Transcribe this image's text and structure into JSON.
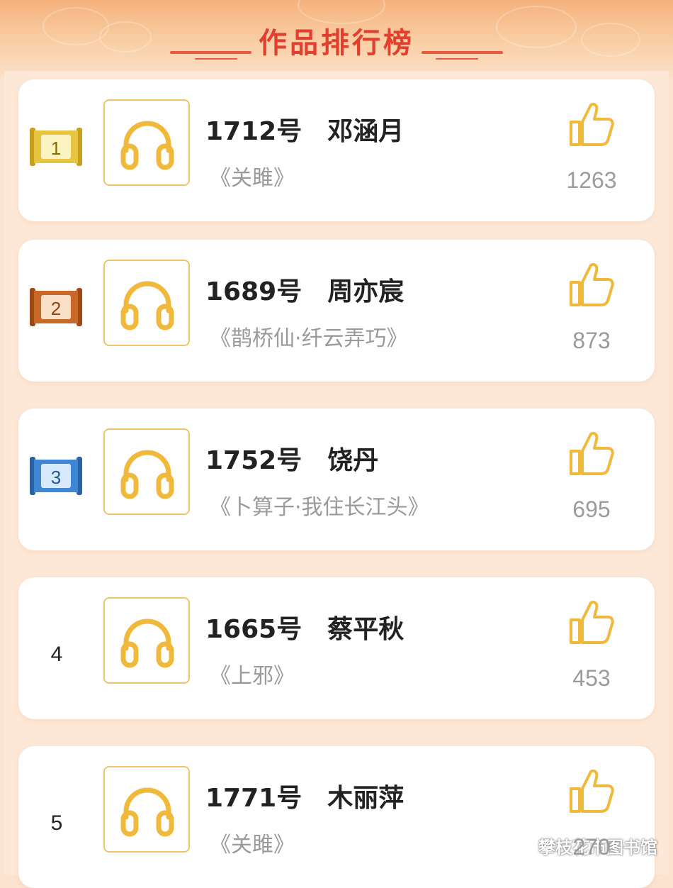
{
  "header": {
    "title": "作品排行榜"
  },
  "colors": {
    "accent": "#e0402d",
    "gold": "#f0b93b",
    "badge_gold": "#e7c540",
    "badge_bronze": "#c8692a",
    "badge_blue": "#3f86d3"
  },
  "entries": [
    {
      "rank": "1",
      "number": "1712号",
      "name": "邓涵月",
      "work": "《关雎》",
      "likes": "1263",
      "badge": "gold"
    },
    {
      "rank": "2",
      "number": "1689号",
      "name": "周亦宸",
      "work": "《鹊桥仙·纤云弄巧》",
      "likes": "873",
      "badge": "bronze"
    },
    {
      "rank": "3",
      "number": "1752号",
      "name": "饶丹",
      "work": "《卜算子·我住长江头》",
      "likes": "695",
      "badge": "blue"
    },
    {
      "rank": "4",
      "number": "1665号",
      "name": "蔡平秋",
      "work": "《上邪》",
      "likes": "453",
      "badge": "none"
    },
    {
      "rank": "5",
      "number": "1771号",
      "name": "木丽萍",
      "work": "《关雎》",
      "likes": "270",
      "badge": "none"
    }
  ],
  "watermark": {
    "text": "攀枝花市图书馆",
    "icon": "wechat-icon"
  }
}
